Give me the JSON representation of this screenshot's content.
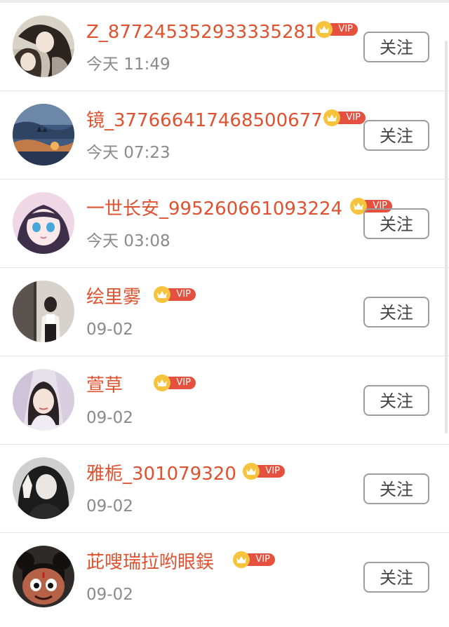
{
  "follow_list": {
    "vip_label": "VIP",
    "follow_label": "关注",
    "items": [
      {
        "name": "Z_8772453529333​35281",
        "time": "今天 11:49"
      },
      {
        "name": "镜_377666417468500677",
        "time": "今天 07:23"
      },
      {
        "name": "一世长安_995260661093224",
        "time": "今天 03:08"
      },
      {
        "name": "绘里雾",
        "time": "09-02"
      },
      {
        "name": "萱草",
        "time": "09-02"
      },
      {
        "name": "雅栀_301079320",
        "time": "09-02"
      },
      {
        "name": "茈嗖瑞拉哟眼鋘",
        "time": "09-02"
      }
    ]
  },
  "colors": {
    "name": "#e0512f",
    "time": "#8a8a8a",
    "vip_pill": "#e5503f",
    "vip_crown": "#f6c33c",
    "button_border": "#9d9d9d"
  }
}
